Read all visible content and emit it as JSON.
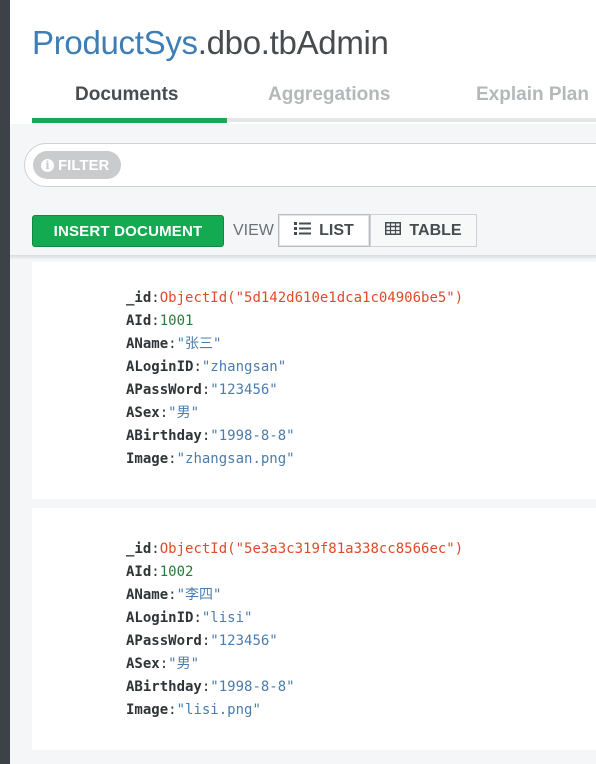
{
  "header": {
    "database": "ProductSys",
    "collection": ".dbo.tbAdmin"
  },
  "tabs": [
    {
      "label": "Documents",
      "active": true
    },
    {
      "label": "Aggregations",
      "active": false
    },
    {
      "label": "Explain Plan",
      "active": false
    }
  ],
  "filter": {
    "label": "FILTER",
    "icon": "info-icon"
  },
  "toolbar": {
    "insert_label": "INSERT DOCUMENT",
    "view_label": "VIEW",
    "list_label": "LIST",
    "table_label": "TABLE",
    "selected_view": "LIST"
  },
  "documents": [
    {
      "fields": [
        {
          "key": "_id",
          "value": "ObjectId(\"5d142d610e1dca1c04906be5\")",
          "type": "objectid"
        },
        {
          "key": "AId",
          "value": "1001",
          "type": "number"
        },
        {
          "key": "AName",
          "value": "\"张三\"",
          "type": "string"
        },
        {
          "key": "ALoginID",
          "value": "\"zhangsan\"",
          "type": "string"
        },
        {
          "key": "APassWord",
          "value": "\"123456\"",
          "type": "string"
        },
        {
          "key": "ASex",
          "value": "\"男\"",
          "type": "string"
        },
        {
          "key": "ABirthday",
          "value": "\"1998-8-8\"",
          "type": "string"
        },
        {
          "key": "Image",
          "value": "\"zhangsan.png\"",
          "type": "string"
        }
      ]
    },
    {
      "fields": [
        {
          "key": "_id",
          "value": "ObjectId(\"5e3a3c319f81a338cc8566ec\")",
          "type": "objectid"
        },
        {
          "key": "AId",
          "value": "1002",
          "type": "number"
        },
        {
          "key": "AName",
          "value": "\"李四\"",
          "type": "string"
        },
        {
          "key": "ALoginID",
          "value": "\"lisi\"",
          "type": "string"
        },
        {
          "key": "APassWord",
          "value": "\"123456\"",
          "type": "string"
        },
        {
          "key": "ASex",
          "value": "\"男\"",
          "type": "string"
        },
        {
          "key": "ABirthday",
          "value": "\"1998-8-8\"",
          "type": "string"
        },
        {
          "key": "Image",
          "value": "\"lisi.png\"",
          "type": "string"
        }
      ]
    }
  ],
  "colors": {
    "brand_green": "#13aa52",
    "db_blue": "#3e7eb5",
    "objectid_red": "#de4b28",
    "string_blue": "#4b7cae",
    "number_green": "#2a7a3a"
  }
}
